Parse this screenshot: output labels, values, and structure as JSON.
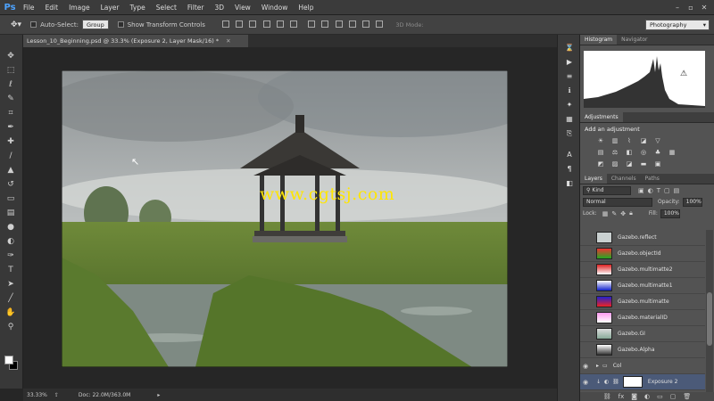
{
  "app": {
    "logo": "Ps",
    "menus": [
      "File",
      "Edit",
      "Image",
      "Layer",
      "Type",
      "Select",
      "Filter",
      "3D",
      "View",
      "Window",
      "Help"
    ]
  },
  "options": {
    "auto_select_label": "Auto-Select:",
    "auto_select_value": "Group",
    "transform_label": "Show Transform Controls",
    "mode3d": "3D Mode:",
    "workspace": "Photography"
  },
  "document": {
    "tab_title": "Lesson_10_Beginning.psd @ 33.3% (Exposure 2, Layer Mask/16) *",
    "watermark": "www.cgtsj.com"
  },
  "status": {
    "zoom": "33.33%",
    "doc": "Doc: 22.0M/363.0M"
  },
  "panels": {
    "histogram_tab": "Histogram",
    "navigator_tab": "Navigator",
    "adjustments_tab": "Adjustments",
    "add_adjustment": "Add an adjustment",
    "layers_tab": "Layers",
    "channels_tab": "Channels",
    "paths_tab": "Paths",
    "kind": "Kind",
    "blend_mode": "Normal",
    "opacity_label": "Opacity:",
    "opacity_value": "100%",
    "lock_label": "Lock:",
    "fill_label": "Fill:",
    "fill_value": "100%"
  },
  "layers": [
    {
      "name": "Gazebo.reflect",
      "visible": false
    },
    {
      "name": "Gazebo.objectId",
      "visible": false
    },
    {
      "name": "Gazebo.multimatte2",
      "visible": false
    },
    {
      "name": "Gazebo.multimatte1",
      "visible": false
    },
    {
      "name": "Gazebo.multimatte",
      "visible": false
    },
    {
      "name": "Gazebo.materialID",
      "visible": false
    },
    {
      "name": "Gazebo.GI",
      "visible": false
    },
    {
      "name": "Gazebo.Alpha",
      "visible": false
    },
    {
      "name": "Col",
      "visible": true,
      "group": true
    },
    {
      "name": "Exposure 2",
      "visible": true,
      "selected": true
    }
  ],
  "colors": {
    "accent": "#4da3ff",
    "selected_layer": "#4b5a78",
    "watermark": "#ffe600"
  }
}
